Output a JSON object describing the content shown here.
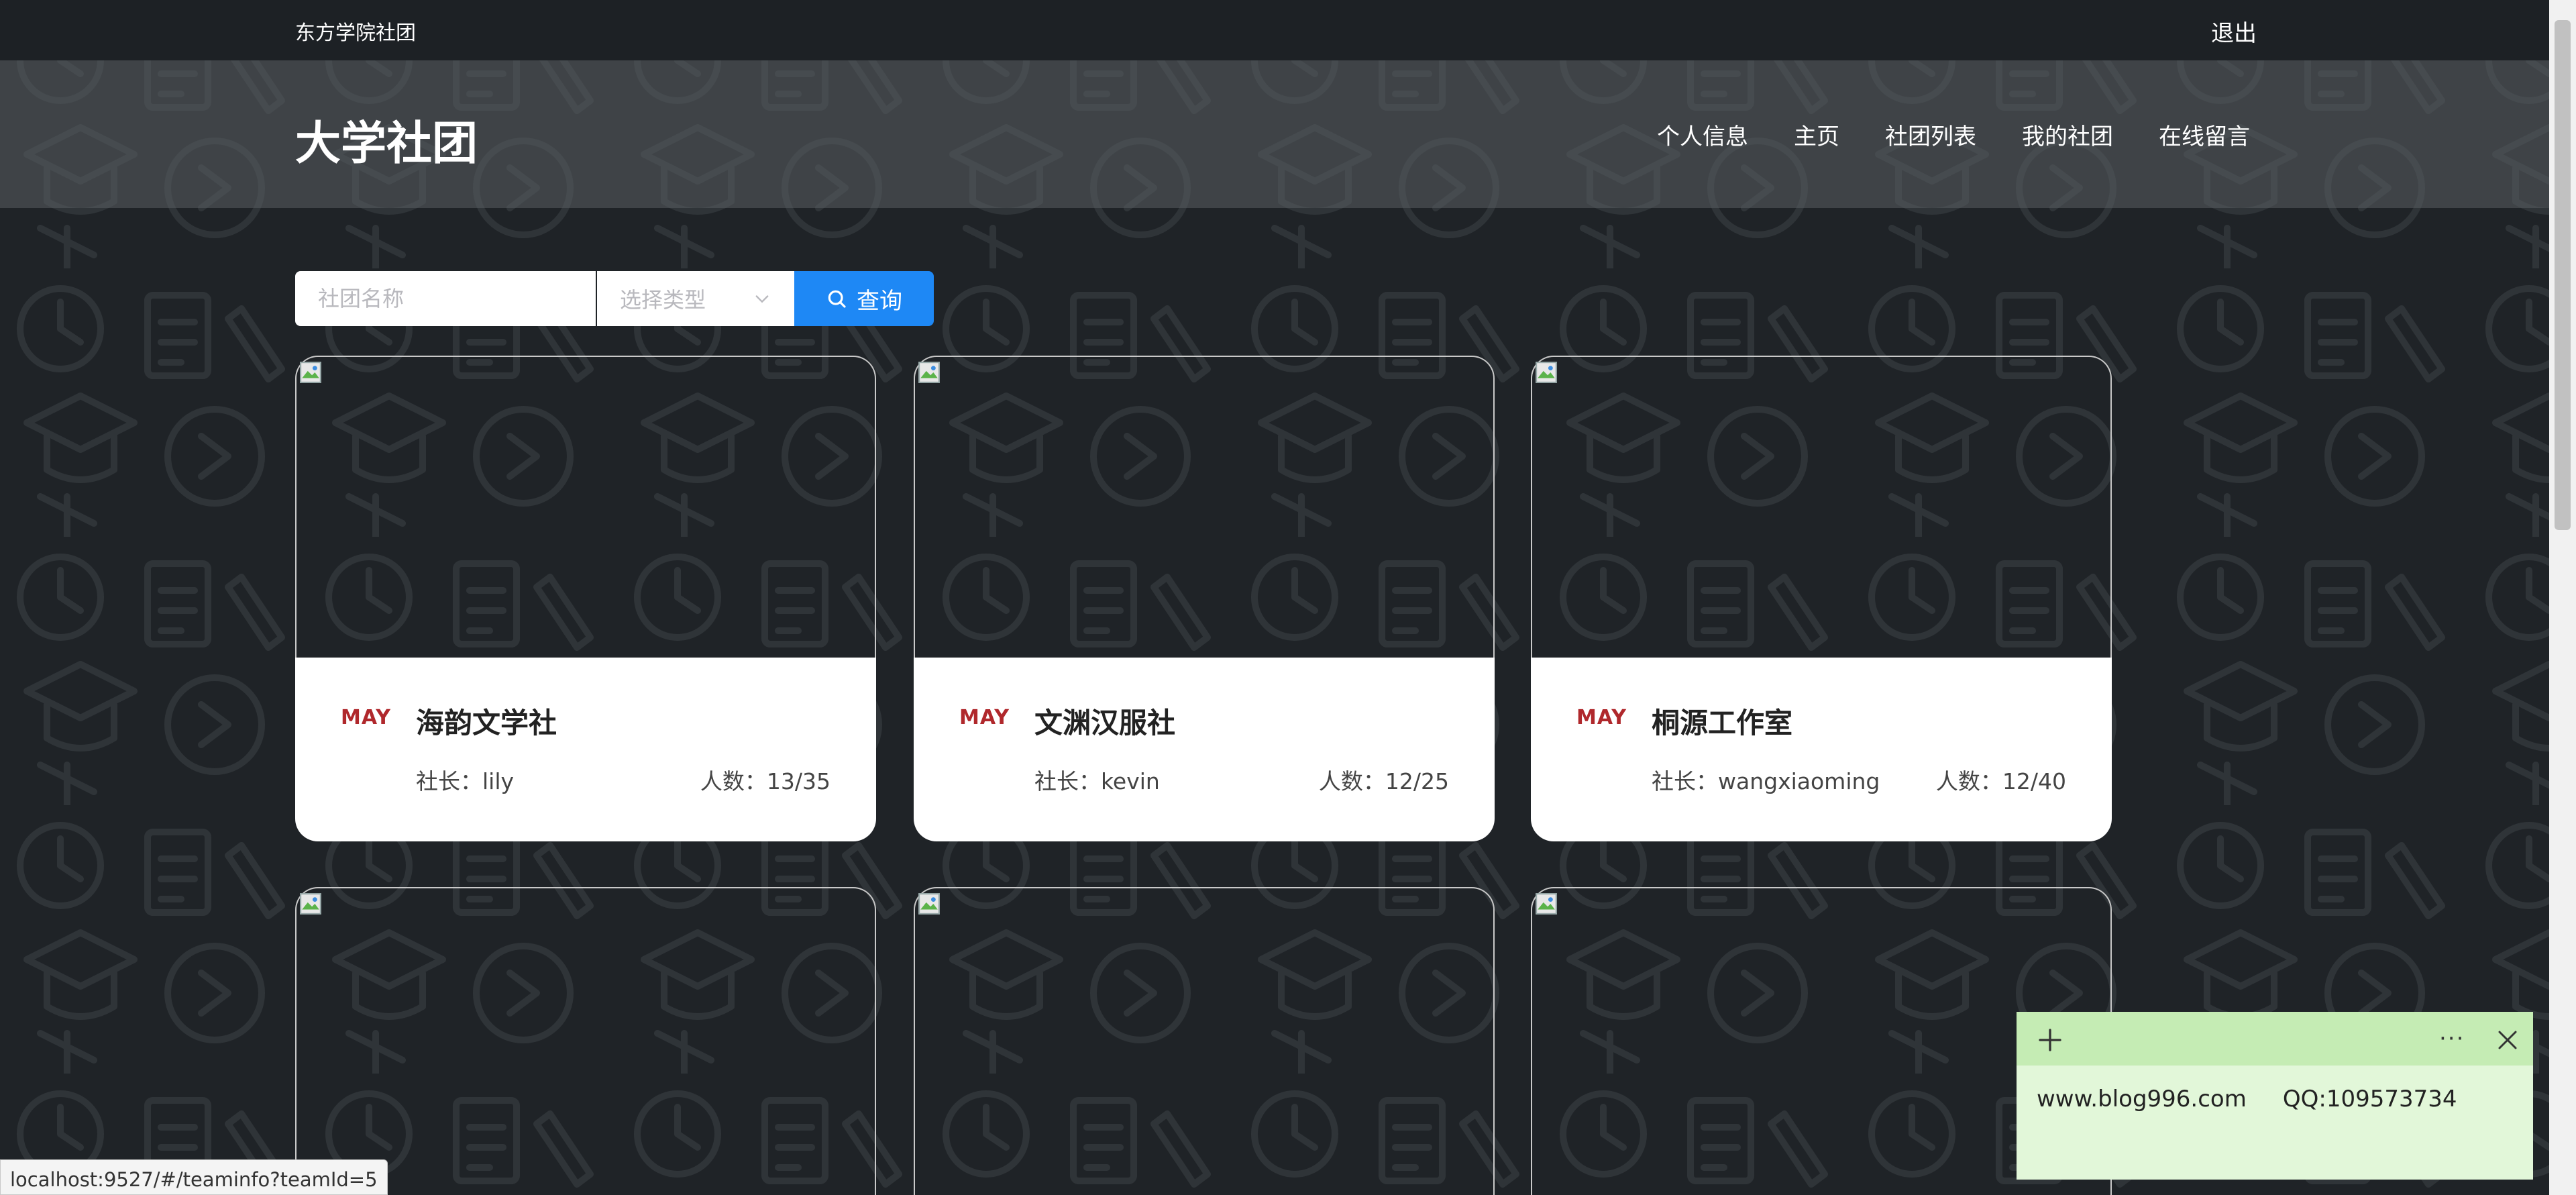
{
  "topbar": {
    "school_name": "东方学院社团",
    "logout_label": "退出"
  },
  "header": {
    "brand": "大学社团",
    "nav": [
      "个人信息",
      "主页",
      "社团列表",
      "我的社团",
      "在线留言"
    ]
  },
  "search": {
    "name_placeholder": "社团名称",
    "type_placeholder": "选择类型",
    "query_label": "查询"
  },
  "cards": [
    {
      "month": "MAY",
      "title": "海韵文学社",
      "leader": "社长：lily",
      "count": "人数：13/35"
    },
    {
      "month": "MAY",
      "title": "文渊汉服社",
      "leader": "社长：kevin",
      "count": "人数：12/25"
    },
    {
      "month": "MAY",
      "title": "桐源工作室",
      "leader": "社长：wangxiaoming",
      "count": "人数：12/40"
    }
  ],
  "sticky_note": {
    "text": "www.blog996.com     QQ:109573734"
  },
  "status_bar": {
    "url": "localhost:9527/#/teaminfo?teamId=5"
  },
  "colors": {
    "background": "#1f2327",
    "accent": "#1e88f5",
    "month": "#b0282c",
    "note": "#e2f7d9"
  }
}
